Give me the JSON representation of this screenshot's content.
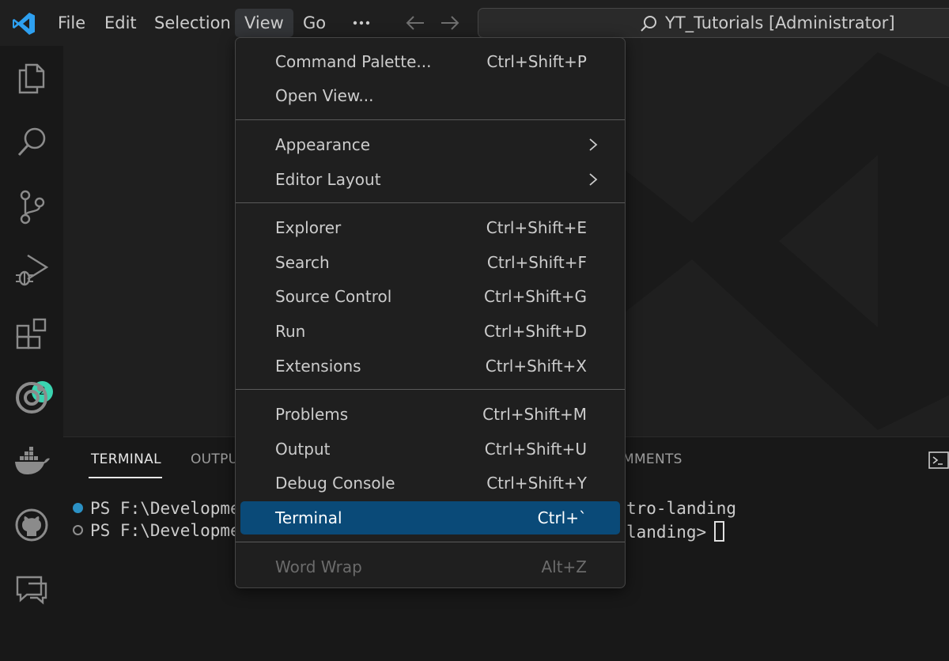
{
  "menubar": {
    "file": "File",
    "edit": "Edit",
    "selection": "Selection",
    "view": "View",
    "go": "Go",
    "more": "···"
  },
  "search": {
    "text": "YT_Tutorials [Administrator]"
  },
  "activitybar": {
    "items": [
      "files-icon",
      "search-icon",
      "source-control-icon",
      "run-debug-icon",
      "extensions-icon",
      "remote-icon",
      "docker-icon",
      "github-icon",
      "comments-icon"
    ],
    "extensions_badge": "2"
  },
  "view_menu": {
    "groups": [
      [
        {
          "label": "Command Palette...",
          "shortcut": "Ctrl+Shift+P"
        },
        {
          "label": "Open View...",
          "shortcut": ""
        }
      ],
      [
        {
          "label": "Appearance",
          "shortcut": "",
          "submenu": true
        },
        {
          "label": "Editor Layout",
          "shortcut": "",
          "submenu": true
        }
      ],
      [
        {
          "label": "Explorer",
          "shortcut": "Ctrl+Shift+E"
        },
        {
          "label": "Search",
          "shortcut": "Ctrl+Shift+F"
        },
        {
          "label": "Source Control",
          "shortcut": "Ctrl+Shift+G"
        },
        {
          "label": "Run",
          "shortcut": "Ctrl+Shift+D"
        },
        {
          "label": "Extensions",
          "shortcut": "Ctrl+Shift+X"
        }
      ],
      [
        {
          "label": "Problems",
          "shortcut": "Ctrl+Shift+M"
        },
        {
          "label": "Output",
          "shortcut": "Ctrl+Shift+U"
        },
        {
          "label": "Debug Console",
          "shortcut": "Ctrl+Shift+Y"
        },
        {
          "label": "Terminal",
          "shortcut": "Ctrl+`",
          "highlighted": true
        }
      ],
      [
        {
          "label": "Word Wrap",
          "shortcut": "Alt+Z",
          "disabled": true
        }
      ]
    ]
  },
  "panel": {
    "tabs": {
      "terminal": "TERMINAL",
      "output": "OUTPU",
      "comments": "MMENTS"
    },
    "terminal_lines": {
      "line1_start": "PS F:\\Developme",
      "line1_end": "tro-landing",
      "line2_start": "PS F:\\Developme",
      "line2_end": "landing>"
    }
  },
  "colors": {
    "accent": "#0a4a78",
    "badge": "#3bd4b0",
    "logo": "#2ea0f0"
  }
}
